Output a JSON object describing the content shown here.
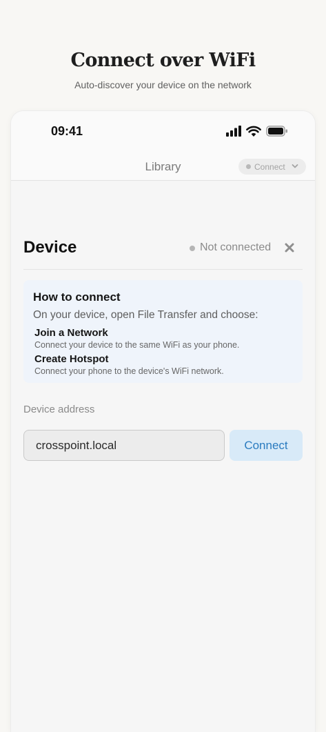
{
  "hero": {
    "title": "Connect over WiFi",
    "subtitle": "Auto-discover your device on the network"
  },
  "status_bar": {
    "time": "09:41",
    "icons": [
      "cellular-signal-icon",
      "wifi-icon",
      "battery-icon"
    ]
  },
  "nav": {
    "title": "Library",
    "connect_label": "Connect",
    "connect_icon": "chevron-down-icon"
  },
  "device_panel": {
    "title": "Device",
    "status": "Not connected",
    "close_icon": "close-icon",
    "how_to": {
      "title": "How to connect",
      "intro": "On your device, open File Transfer and choose:",
      "options": [
        {
          "title": "Join a Network",
          "description": "Connect your device to the same WiFi as your phone."
        },
        {
          "title": "Create Hotspot",
          "description": "Connect your phone to the device's WiFi network."
        }
      ]
    },
    "address_label": "Device address",
    "address_value": "crosspoint.local",
    "connect_button": "Connect"
  },
  "colors": {
    "page_background": "#f8f7f4",
    "info_box": "#eff4fb",
    "accent_text": "#2a7bbf",
    "accent_button": "#d8eaf8",
    "status_dot": "#b5b5b5"
  }
}
